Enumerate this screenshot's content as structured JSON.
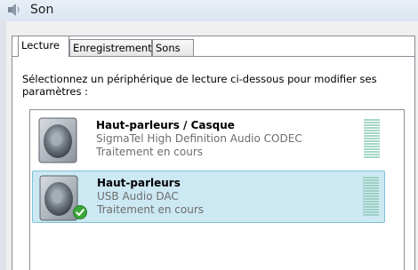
{
  "window": {
    "title": "Son",
    "icon": "speaker-icon"
  },
  "tabs": [
    {
      "label": "Lecture",
      "active": true
    },
    {
      "label": "Enregistrement",
      "active": false
    },
    {
      "label": "Sons",
      "active": false
    }
  ],
  "instruction": "Sélectionnez un périphérique de lecture ci-dessous pour modifier ses paramètres :",
  "devices": [
    {
      "name": "Haut-parleurs / Casque",
      "description": "SigmaTel High Definition Audio CODEC",
      "status": "Traitement en cours",
      "icon": "speaker-icon",
      "selected": false,
      "default": false
    },
    {
      "name": "Haut-parleurs",
      "description": "USB Audio DAC",
      "status": "Traitement en cours",
      "icon": "speaker-icon",
      "selected": true,
      "default": true,
      "default_badge_icon": "green-check-icon"
    }
  ],
  "colors": {
    "selection_background": "#cce8f3",
    "selection_border": "#7fc2dc",
    "meter_green": "#a6d8c7",
    "default_badge": "#3aa83a"
  }
}
